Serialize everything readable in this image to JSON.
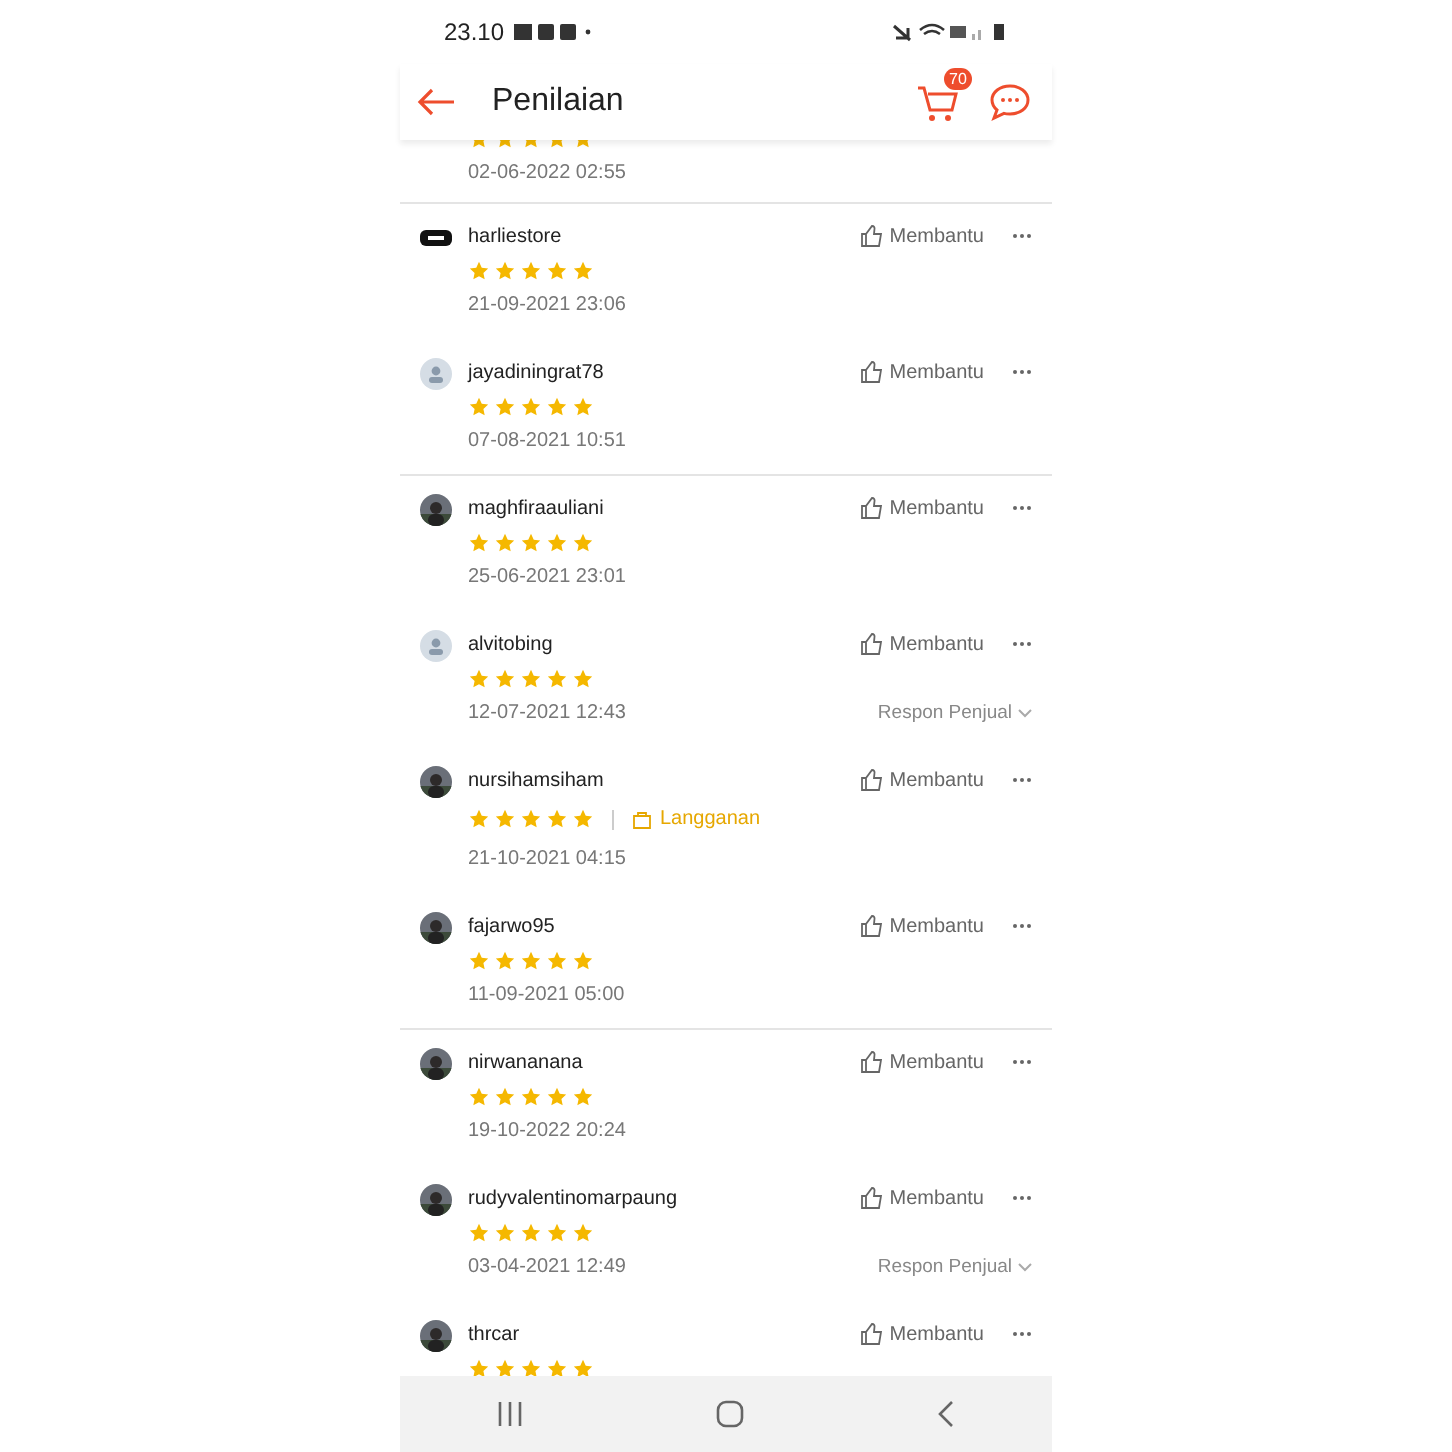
{
  "status_bar": {
    "time": "23.10"
  },
  "header": {
    "title": "Penilaian",
    "cart_count": "70"
  },
  "reviews": [
    {
      "partial": true,
      "stars": 5,
      "date": "02-06-2022 02:55",
      "divider": true
    },
    {
      "user": "harliestore",
      "avatar": {
        "kind": "logo"
      },
      "stars": 5,
      "date": "21-09-2021 23:06",
      "helpful": "Membantu",
      "divider": false
    },
    {
      "user": "jayadiningrat78",
      "avatar": {
        "kind": "default"
      },
      "stars": 5,
      "date": "07-08-2021 10:51",
      "helpful": "Membantu",
      "divider": true
    },
    {
      "user": "maghfiraauliani",
      "stars": 5,
      "date": "25-06-2021 23:01",
      "helpful": "Membantu",
      "divider": false
    },
    {
      "user": "alvitobing",
      "avatar": {
        "kind": "default"
      },
      "stars": 5,
      "date": "12-07-2021 12:43",
      "helpful": "Membantu",
      "seller_reply": "Respon Penjual",
      "divider": false
    },
    {
      "user": "nursihamsiham",
      "stars": 5,
      "subscription": "Langganan",
      "date": "21-10-2021 04:15",
      "helpful": "Membantu",
      "divider": false
    },
    {
      "user": "fajarwo95",
      "stars": 5,
      "date": "11-09-2021 05:00",
      "helpful": "Membantu",
      "divider": true
    },
    {
      "user": "nirwananana",
      "stars": 5,
      "date": "19-10-2022 20:24",
      "helpful": "Membantu",
      "divider": false
    },
    {
      "user": "rudyvalentinomarpaung",
      "stars": 5,
      "date": "03-04-2021 12:49",
      "helpful": "Membantu",
      "seller_reply": "Respon Penjual",
      "divider": false
    },
    {
      "user": "thrcar",
      "stars": 5,
      "helpful": "Membantu"
    }
  ]
}
